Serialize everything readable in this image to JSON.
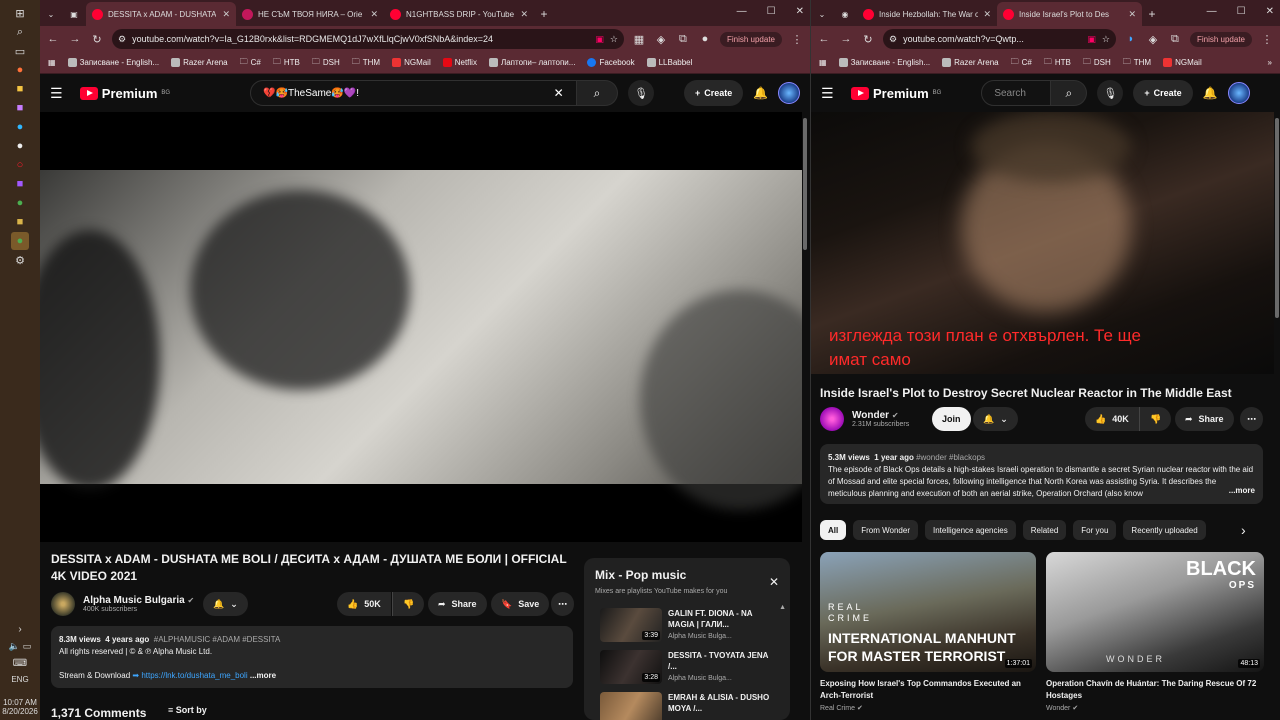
{
  "taskbar": {
    "lang": "ENG",
    "time": "10:07 AM",
    "date": "8/20/2026"
  },
  "left": {
    "tabs": [
      {
        "title": "DESSITA x ADAM - DUSHATA",
        "active": true
      },
      {
        "title": "НЕ СЪМ ТВОЯ НИRA – Orie",
        "active": false
      },
      {
        "title": "N1GHTBASS DRIP - YouTube",
        "active": false
      }
    ],
    "url": "youtube.com/watch?v=Ia_G12B0rxk&list=RDGMEMQ1dJ7wXfLlqCjwV0xfSNbA&index=24",
    "finish_update": "Finish update",
    "bookmarks": [
      "Записване - English...",
      "Razer Arena",
      "C#",
      "НТВ",
      "DSH",
      "THM",
      "NGMail",
      "Netflix",
      "Лаптопи– лаптопи...",
      "Facebook",
      "LLBabbel"
    ],
    "logo": "Premium",
    "logo_region": "BG",
    "search_value": "💔🥵TheSame🥵💜!",
    "create": "Create",
    "video": {
      "title": "DESSITA x ADAM - DUSHATA ME BOLI / ДЕСИТА x АДАМ - ДУШАТА МЕ БОЛИ | OFFICIAL 4K VIDEO 2021",
      "channel": "Alpha Music Bulgaria",
      "subs": "400K subscribers",
      "likes": "50K",
      "share": "Share",
      "save": "Save",
      "views": "8.3M views",
      "age": "4 years ago",
      "tags": "#ALPHAMUSIC #ADAM #DESSITA",
      "rights": "All rights reserved | © & ℗ Alpha Music Ltd.",
      "stream": "Stream & Download ",
      "link": "https://lnk.to/dushata_me_boli",
      "more": "...more",
      "comments": "1,371 Comments",
      "sort": "Sort by"
    },
    "mix": {
      "title": "Mix - Pop music",
      "subtitle": "Mixes are playlists YouTube makes for you",
      "items": [
        {
          "title": "GALIN FT. DIONA - NA MAGIA | ГАЛИ...",
          "channel": "Alpha Music Bulga...",
          "duration": "3:39"
        },
        {
          "title": "DESSITA - TVOYATA JENA /...",
          "channel": "Alpha Music Bulga...",
          "duration": "3:28"
        },
        {
          "title": "EMRAH & ALISIA - DUSHO MOYA /...",
          "channel": "",
          "duration": ""
        }
      ]
    }
  },
  "right": {
    "tabs": [
      {
        "title": "Inside Hezbollah: The War o",
        "active": false
      },
      {
        "title": "Inside Israel's Plot to Des",
        "active": true
      }
    ],
    "url": "youtube.com/watch?v=Qwtp...",
    "finish_update": "Finish update",
    "bookmarks": [
      "Записване - English...",
      "Razer Arena",
      "C#",
      "НТВ",
      "DSH",
      "THM",
      "NGMail"
    ],
    "search_placeholder": "Search",
    "create": "Create",
    "subtitle_line1": "изглежда този план е отхвърлен. Те ще",
    "subtitle_line2": "имат само",
    "video": {
      "title": "Inside Israel's Plot to Destroy Secret Nuclear Reactor in The Middle East",
      "channel": "Wonder",
      "subs": "2.31M subscribers",
      "join": "Join",
      "likes": "40K",
      "share": "Share",
      "views": "5.3M views",
      "age": "1 year ago",
      "tags": "#wonder #blackops",
      "description": "The episode of Black Ops details a high-stakes Israeli operation to dismantle a secret Syrian nuclear reactor with the aid of Mossad and elite special forces, following intelligence that North Korea was assisting Syria. It describes the meticulous planning and execution of both an aerial strike, Operation Orchard (also know",
      "more": "...more"
    },
    "chips": [
      "All",
      "From Wonder",
      "Intelligence agencies",
      "Related",
      "For you",
      "Recently uploaded"
    ],
    "cards": [
      {
        "title": "Exposing How Israel's Top Commandos Executed an Arch-Terrorist",
        "channel": "Real Crime",
        "duration": "1:37:01",
        "thumb_text1": "INTERNATIONAL MANHUNT",
        "thumb_text2": "FOR MASTER TERRORIST",
        "thumb_brand": "REAL CRIME"
      },
      {
        "title": "Operation Chavín de Huántar: The Daring Rescue Of 72 Hostages",
        "channel": "Wonder",
        "duration": "48:13",
        "thumb_text1": "BLACK",
        "thumb_text2": "OPS",
        "thumb_brand": "WONDER"
      }
    ]
  }
}
